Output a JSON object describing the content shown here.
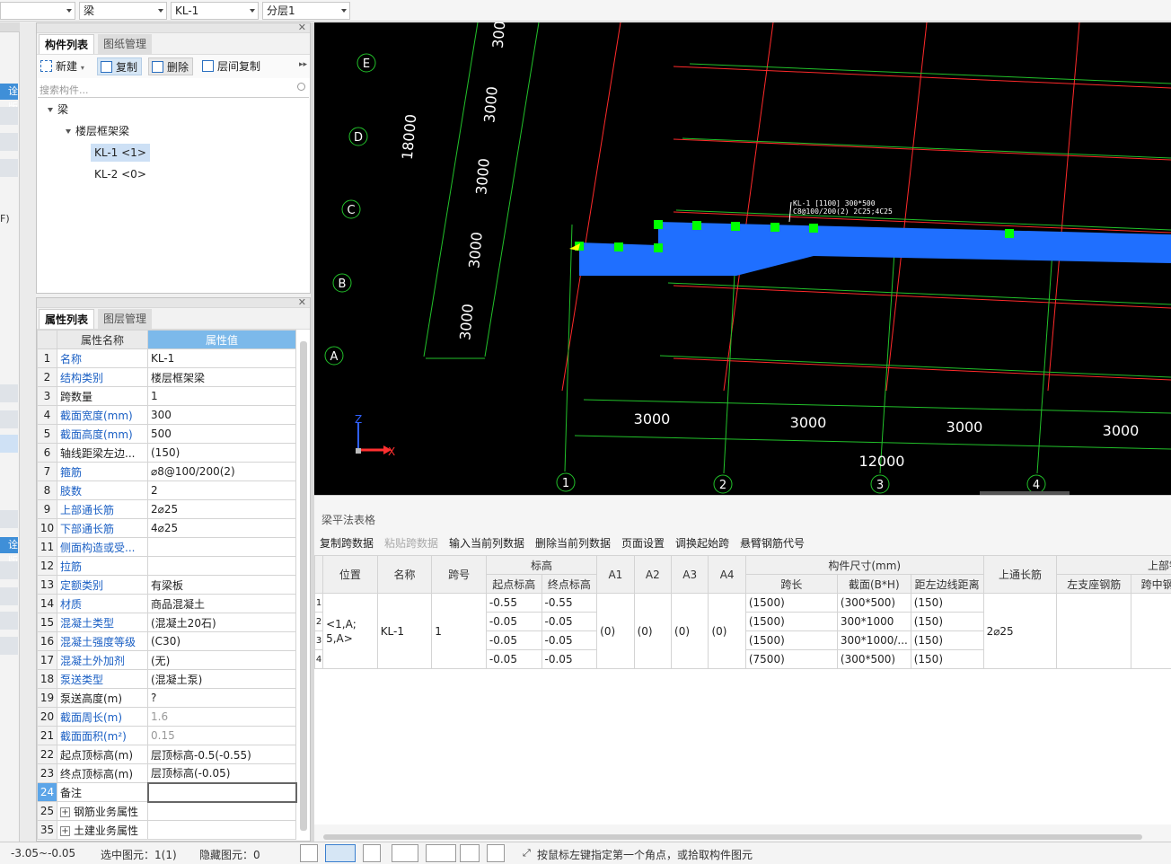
{
  "topbar": {
    "combo_first": "",
    "combo_type": "梁",
    "combo_component": "KL-1",
    "combo_layer": "分层1"
  },
  "left_strip": {
    "tag1": "诠版",
    "tag2": "诠版",
    "partial_text": "F)"
  },
  "component_panel": {
    "tabs": [
      "构件列表",
      "图纸管理"
    ],
    "toolbar": {
      "new_label": "新建",
      "copy_label": "复制",
      "delete_label": "删除",
      "floor_copy_label": "层间复制"
    },
    "search_placeholder": "搜索构件...",
    "tree": {
      "root": "梁",
      "group": "楼层框架梁",
      "items": [
        "KL-1 <1>",
        "KL-2 <0>"
      ]
    }
  },
  "property_panel": {
    "tabs": [
      "属性列表",
      "图层管理"
    ],
    "header_name": "属性名称",
    "header_value": "属性值",
    "rows": [
      {
        "no": "1",
        "name": "名称",
        "value": "KL-1",
        "blue": true
      },
      {
        "no": "2",
        "name": "结构类别",
        "value": "楼层框架梁",
        "blue": true
      },
      {
        "no": "3",
        "name": "跨数量",
        "value": "1",
        "blue": false
      },
      {
        "no": "4",
        "name": "截面宽度(mm)",
        "value": "300",
        "blue": true
      },
      {
        "no": "5",
        "name": "截面高度(mm)",
        "value": "500",
        "blue": true
      },
      {
        "no": "6",
        "name": "轴线距梁左边...",
        "value": "(150)",
        "blue": false
      },
      {
        "no": "7",
        "name": "箍筋",
        "value": "⌀8@100/200(2)",
        "blue": true
      },
      {
        "no": "8",
        "name": "肢数",
        "value": "2",
        "blue": true
      },
      {
        "no": "9",
        "name": "上部通长筋",
        "value": "2⌀25",
        "blue": true
      },
      {
        "no": "10",
        "name": "下部通长筋",
        "value": "4⌀25",
        "blue": true
      },
      {
        "no": "11",
        "name": "侧面构造或受...",
        "value": "",
        "blue": true
      },
      {
        "no": "12",
        "name": "拉筋",
        "value": "",
        "blue": true
      },
      {
        "no": "13",
        "name": "定额类别",
        "value": "有梁板",
        "blue": true
      },
      {
        "no": "14",
        "name": "材质",
        "value": "商品混凝土",
        "blue": true
      },
      {
        "no": "15",
        "name": "混凝土类型",
        "value": "(混凝土20石)",
        "blue": true
      },
      {
        "no": "16",
        "name": "混凝土强度等级",
        "value": "(C30)",
        "blue": true
      },
      {
        "no": "17",
        "name": "混凝土外加剂",
        "value": "(无)",
        "blue": true
      },
      {
        "no": "18",
        "name": "泵送类型",
        "value": "(混凝土泵)",
        "blue": true
      },
      {
        "no": "19",
        "name": "泵送高度(m)",
        "value": "?",
        "blue": false
      },
      {
        "no": "20",
        "name": "截面周长(m)",
        "value": "1.6",
        "blue": true,
        "grey": true
      },
      {
        "no": "21",
        "name": "截面面积(m²)",
        "value": "0.15",
        "blue": true,
        "grey": true
      },
      {
        "no": "22",
        "name": "起点顶标高(m)",
        "value": "层顶标高-0.5(-0.55)",
        "blue": false
      },
      {
        "no": "23",
        "name": "终点顶标高(m)",
        "value": "层顶标高(-0.05)",
        "blue": false
      },
      {
        "no": "24",
        "name": "备注",
        "value": "",
        "blue": false,
        "current": true
      },
      {
        "no": "25",
        "name": "钢筋业务属性",
        "value": "",
        "blue": false,
        "expand": true
      },
      {
        "no": "35",
        "name": "土建业务属性",
        "value": "",
        "blue": false,
        "expand": true
      }
    ]
  },
  "canvas": {
    "axis_labels_rows": [
      "E",
      "D",
      "C",
      "B",
      "A"
    ],
    "axis_labels_cols": [
      "1",
      "2",
      "3",
      "4"
    ],
    "dims_vertical": [
      "300",
      "3000",
      "3000",
      "3000",
      "3000"
    ],
    "dim_total_vertical": "18000",
    "dims_horizontal": [
      "3000",
      "3000",
      "3000",
      "3000"
    ],
    "dim_total_horizontal": "12000",
    "beam_label_line1": "KL-1 [1100] 300*500",
    "beam_label_line2": "C8@100/200(2) 2C25;4C25",
    "gizmo_z": "Z",
    "gizmo_x": "X",
    "colors": {
      "grid_red": "#ff2a2a",
      "grid_green": "#22c12a",
      "beam": "#1f6fff",
      "grip": "#00ff00"
    }
  },
  "beam_table": {
    "title": "梁平法表格",
    "toolbar": [
      "复制跨数据",
      "粘贴跨数据",
      "输入当前列数据",
      "删除当前列数据",
      "页面设置",
      "调换起始跨",
      "悬臂钢筋代号"
    ],
    "disabled_tool": "粘贴跨数据",
    "headers": {
      "position": "位置",
      "name": "名称",
      "span": "跨号",
      "elev_group": "标高",
      "elev_start": "起点标高",
      "elev_end": "终点标高",
      "a1": "A1",
      "a2": "A2",
      "a3": "A3",
      "a4": "A4",
      "size_group": "构件尺寸(mm)",
      "span_len": "跨长",
      "section": "截面(B*H)",
      "offset": "距左边线距离",
      "top_through": "上通长筋",
      "top_group": "上部钢",
      "left_seat": "左支座钢筋",
      "span_mid": "跨中钢"
    },
    "row_numbers": [
      "1",
      "2",
      "3",
      "4"
    ],
    "position": "<1,A;\n5,A>",
    "name": "KL-1",
    "span": "1",
    "a_values": [
      "(0)",
      "(0)",
      "(0)",
      "(0)"
    ],
    "top_through": "2⌀25",
    "rows": [
      {
        "start": "-0.55",
        "end": "-0.55",
        "span_len": "(1500)",
        "section": "(300*500)",
        "offset": "(150)"
      },
      {
        "start": "-0.05",
        "end": "-0.05",
        "span_len": "(1500)",
        "section": "300*1000",
        "offset": "(150)"
      },
      {
        "start": "-0.05",
        "end": "-0.05",
        "span_len": "(1500)",
        "section": "300*1000/...",
        "offset": "(150)"
      },
      {
        "start": "-0.05",
        "end": "-0.05",
        "span_len": "(7500)",
        "section": "(300*500)",
        "offset": "(150)"
      }
    ]
  },
  "statusbar": {
    "elevation": "-3.05~-0.05",
    "selected": "选中图元：1(1)",
    "hidden": "隐藏图元：0",
    "hint": "按鼠标左键指定第一个角点，或拾取构件图元"
  }
}
